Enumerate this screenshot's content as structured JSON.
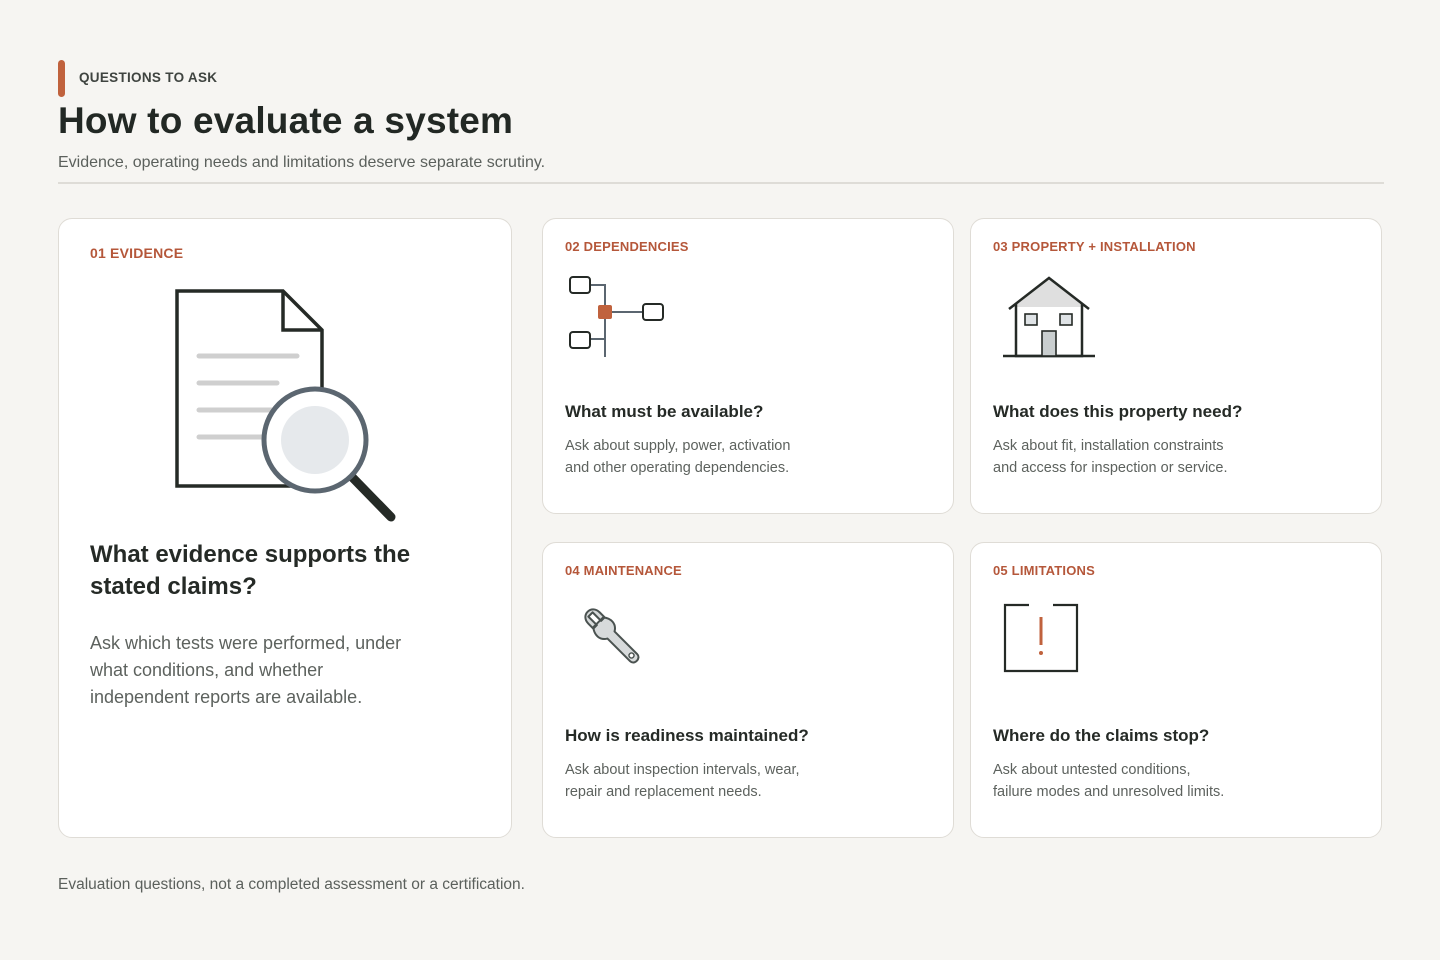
{
  "header": {
    "eyebrow": "QUESTIONS TO ASK",
    "title": "How to evaluate a system",
    "subtitle": "Evidence, operating needs and limitations deserve separate scrutiny."
  },
  "colors": {
    "accent": "#c0623d",
    "background": "#f6f5f2",
    "card": "#ffffff",
    "text": "#222824"
  },
  "cards": [
    {
      "tag": "01 EVIDENCE",
      "icon": "document-magnifier-icon",
      "question": "What evidence supports the stated claims?",
      "body": "Ask which tests were performed, under what conditions, and whether independent reports are available."
    },
    {
      "tag": "02 DEPENDENCIES",
      "icon": "dependency-nodes-icon",
      "question": "What must be available?",
      "body": "Ask about supply, power, activation\nand other operating dependencies."
    },
    {
      "tag": "03 PROPERTY + INSTALLATION",
      "icon": "house-icon",
      "question": "What does this property need?",
      "body": "Ask about fit, installation constraints\nand access for inspection or service."
    },
    {
      "tag": "04 MAINTENANCE",
      "icon": "wrench-icon",
      "question": "How is readiness maintained?",
      "body": "Ask about inspection intervals, wear,\nrepair and replacement needs."
    },
    {
      "tag": "05 LIMITATIONS",
      "icon": "warning-box-icon",
      "question": "Where do the claims stop?",
      "body": "Ask about untested conditions,\nfailure modes and unresolved limits."
    }
  ],
  "footnote": "Evaluation questions, not a completed assessment or a certification."
}
